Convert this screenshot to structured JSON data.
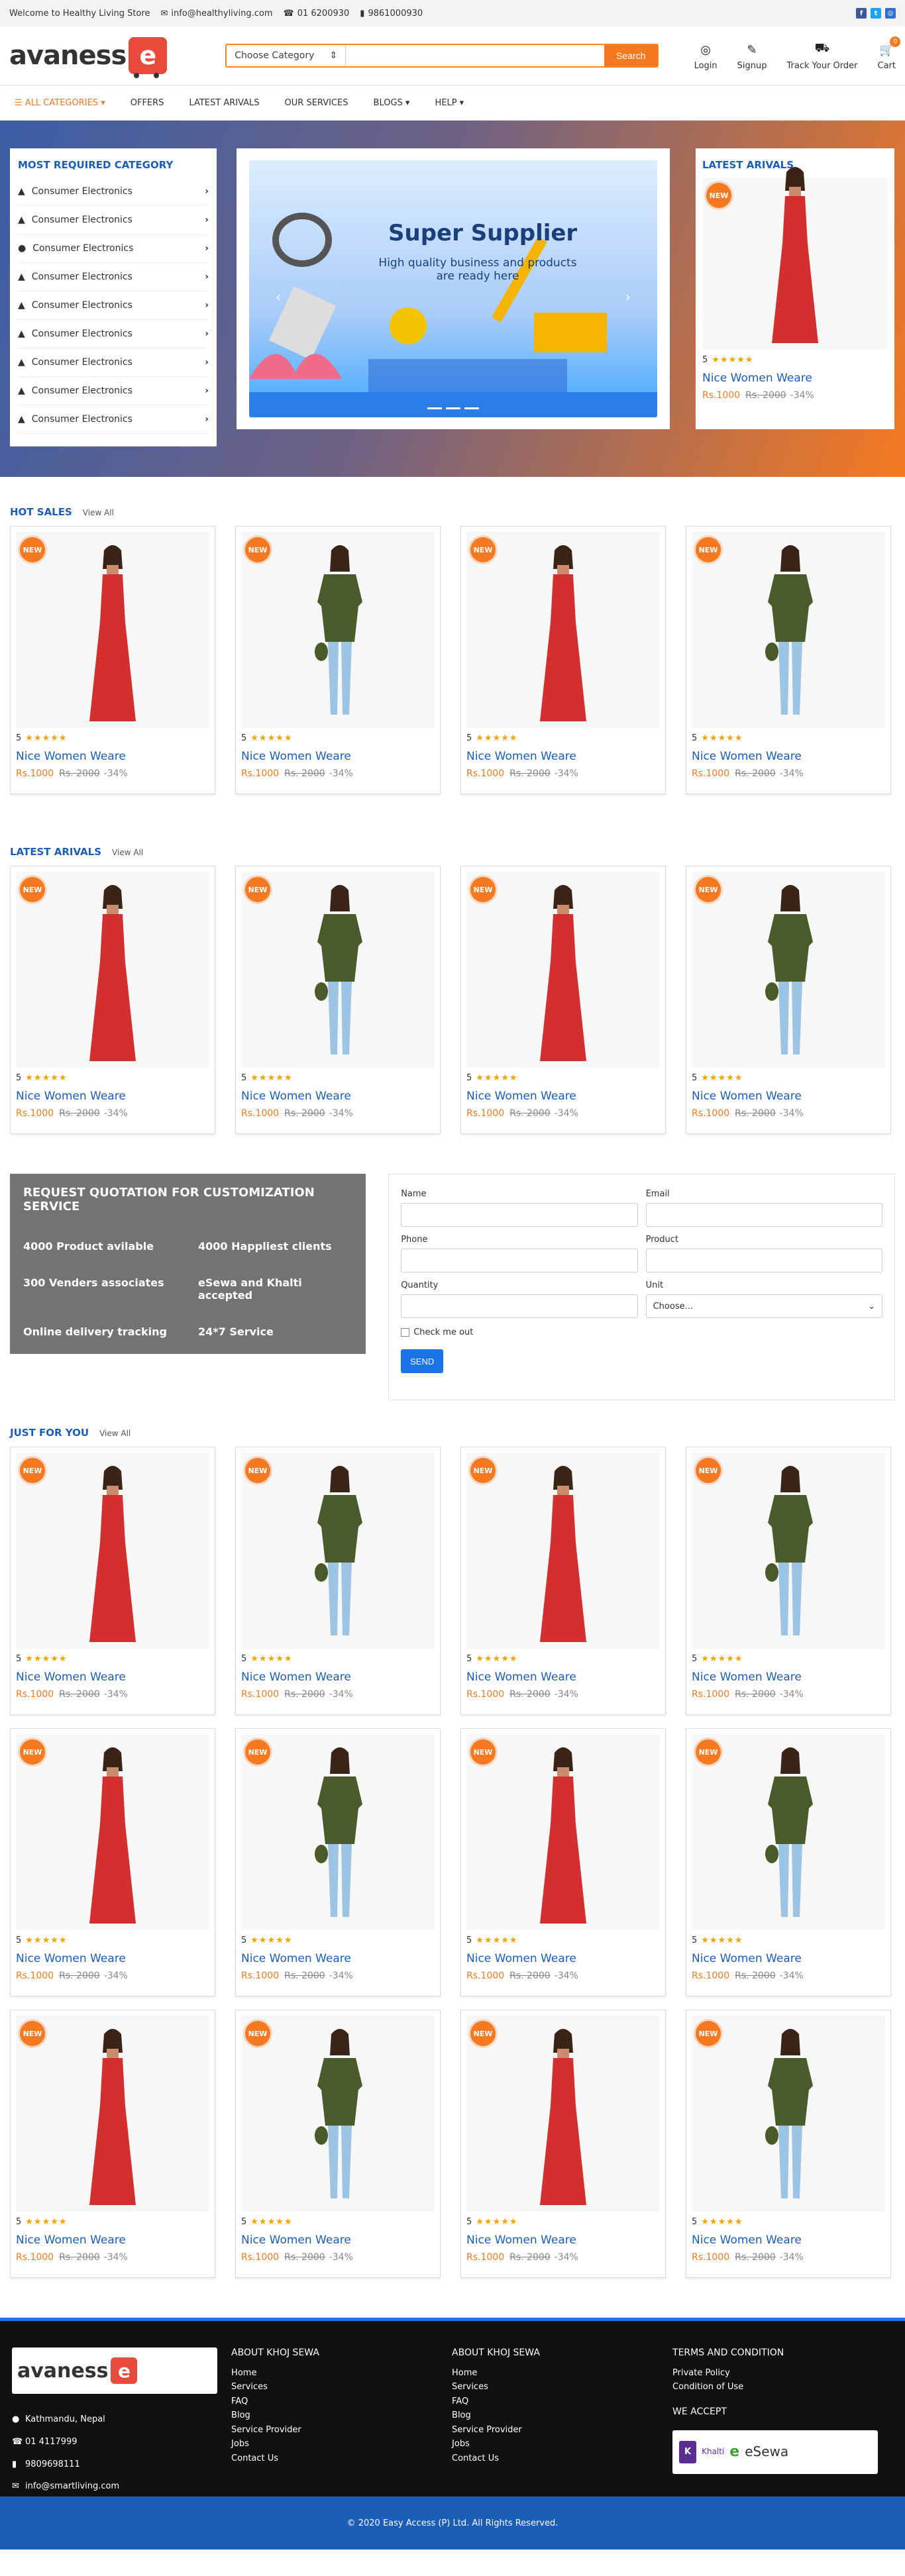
{
  "topbar": {
    "welcome": "Welcome to Healthy Living Store",
    "email": "info@healthyliving.com",
    "phone1": "01 6200930",
    "phone2": "9861000930"
  },
  "header": {
    "logo_text": "avaness",
    "search": {
      "category_label": "Choose Category",
      "placeholder": "",
      "button": "Search"
    },
    "icons": [
      {
        "name": "login",
        "label": "Login",
        "glyph": "☺"
      },
      {
        "name": "signup",
        "label": "Signup",
        "glyph": "☻"
      },
      {
        "name": "track",
        "label": "Track Your Order",
        "glyph": "■"
      },
      {
        "name": "cart",
        "label": "Cart",
        "glyph": "■",
        "badge": "0"
      }
    ]
  },
  "nav": {
    "all": "ALL CATEGORIES",
    "items": [
      "OFFERS",
      "LATEST ARIVALS",
      "OUR SERVICES",
      "BLOGS",
      "HELP"
    ]
  },
  "hero": {
    "categories_title": "MOST REQUIRED CATEGORY",
    "categories": [
      "Consumer Electronics",
      "Consumer Electronics",
      "Consumer Electronics",
      "Consumer Electronics",
      "Consumer Electronics",
      "Consumer Electronics",
      "Consumer Electronics",
      "Consumer Electronics",
      "Consumer Electronics"
    ],
    "banner_title": "Super Supplier",
    "banner_sub": "High quality business and products are ready here",
    "latest_title": "LATEST ARIVALS"
  },
  "product": {
    "badge": "NEW",
    "rating": "5",
    "stars": "★★★★★",
    "name": "Nice Women Weare",
    "price": "Rs.1000",
    "old_price": "Rs. 2000",
    "off": "-34%"
  },
  "sections": {
    "hot": "HOT SALES",
    "latest": "LATEST ARIVALS",
    "just": "JUST FOR YOU",
    "view_all": "View All"
  },
  "quote": {
    "title": "REQUEST QUOTATION FOR CUSTOMIZATION SERVICE",
    "facts": [
      "4000 Product avilable",
      "4000 Happliest clients",
      "300 Venders associates",
      "eSewa and Khalti accepted",
      "Online delivery tracking",
      "24*7 Service"
    ],
    "labels": {
      "name": "Name",
      "email": "Email",
      "phone": "Phone",
      "product": "Product",
      "quantity": "Quantity",
      "unit": "Unit",
      "unit_value": "Choose...",
      "check": "Check me out",
      "send": "SEND"
    }
  },
  "footer": {
    "contact": [
      "Kathmandu, Nepal",
      "01 4117999",
      "9809698111",
      "info@smartliving.com"
    ],
    "col1_title": "ABOUT KHOJ SEWA",
    "col2_title": "ABOUT KHOJ SEWA",
    "links": [
      "Home",
      "Services",
      "FAQ",
      "Blog",
      "Service Provider",
      "Jobs",
      "Contact Us"
    ],
    "terms_title": "TERMS AND CONDITION",
    "terms": [
      "Private Policy",
      "Condition of Use"
    ],
    "accept_title": "WE ACCEPT",
    "payments": [
      "Khalti",
      "eSewa"
    ],
    "copyright": "© 2020 Easy Access (P) Ltd. All Rights Reserved."
  },
  "colors": {
    "accent": "#f47920",
    "brand": "#1b5eb8",
    "red_dress": "#d32f2f",
    "green_dress": "#4a5a2a"
  }
}
